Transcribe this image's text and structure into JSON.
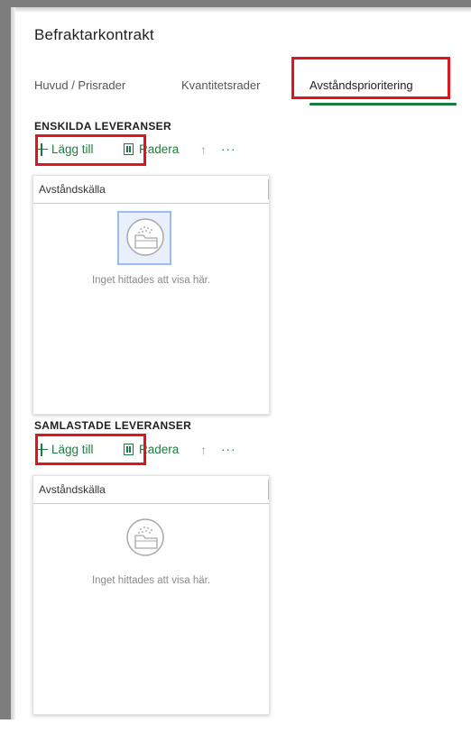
{
  "page": {
    "title": "Befraktarkontrakt"
  },
  "tabs": [
    {
      "label": "Huvud / Prisrader"
    },
    {
      "label": "Kvantitetsrader"
    },
    {
      "label": "Avståndsprioritering"
    }
  ],
  "sections": [
    {
      "title": "ENSKILDA LEVERANSER",
      "toolbar": {
        "add_label": "Lägg till",
        "delete_label": "Radera",
        "up_glyph": "↑",
        "more_glyph": "···"
      },
      "grid": {
        "column": "Avståndskälla",
        "empty_text": "Inget hittades att visa här."
      }
    },
    {
      "title": "SAMLASTADE LEVERANSER",
      "toolbar": {
        "add_label": "Lägg till",
        "delete_label": "Radera",
        "up_glyph": "↑",
        "more_glyph": "···"
      },
      "grid": {
        "column": "Avståndskälla",
        "empty_text": "Inget hittades att visa här."
      }
    }
  ],
  "colors": {
    "accent": "#1b7d3d",
    "highlight": "#e0141e"
  }
}
